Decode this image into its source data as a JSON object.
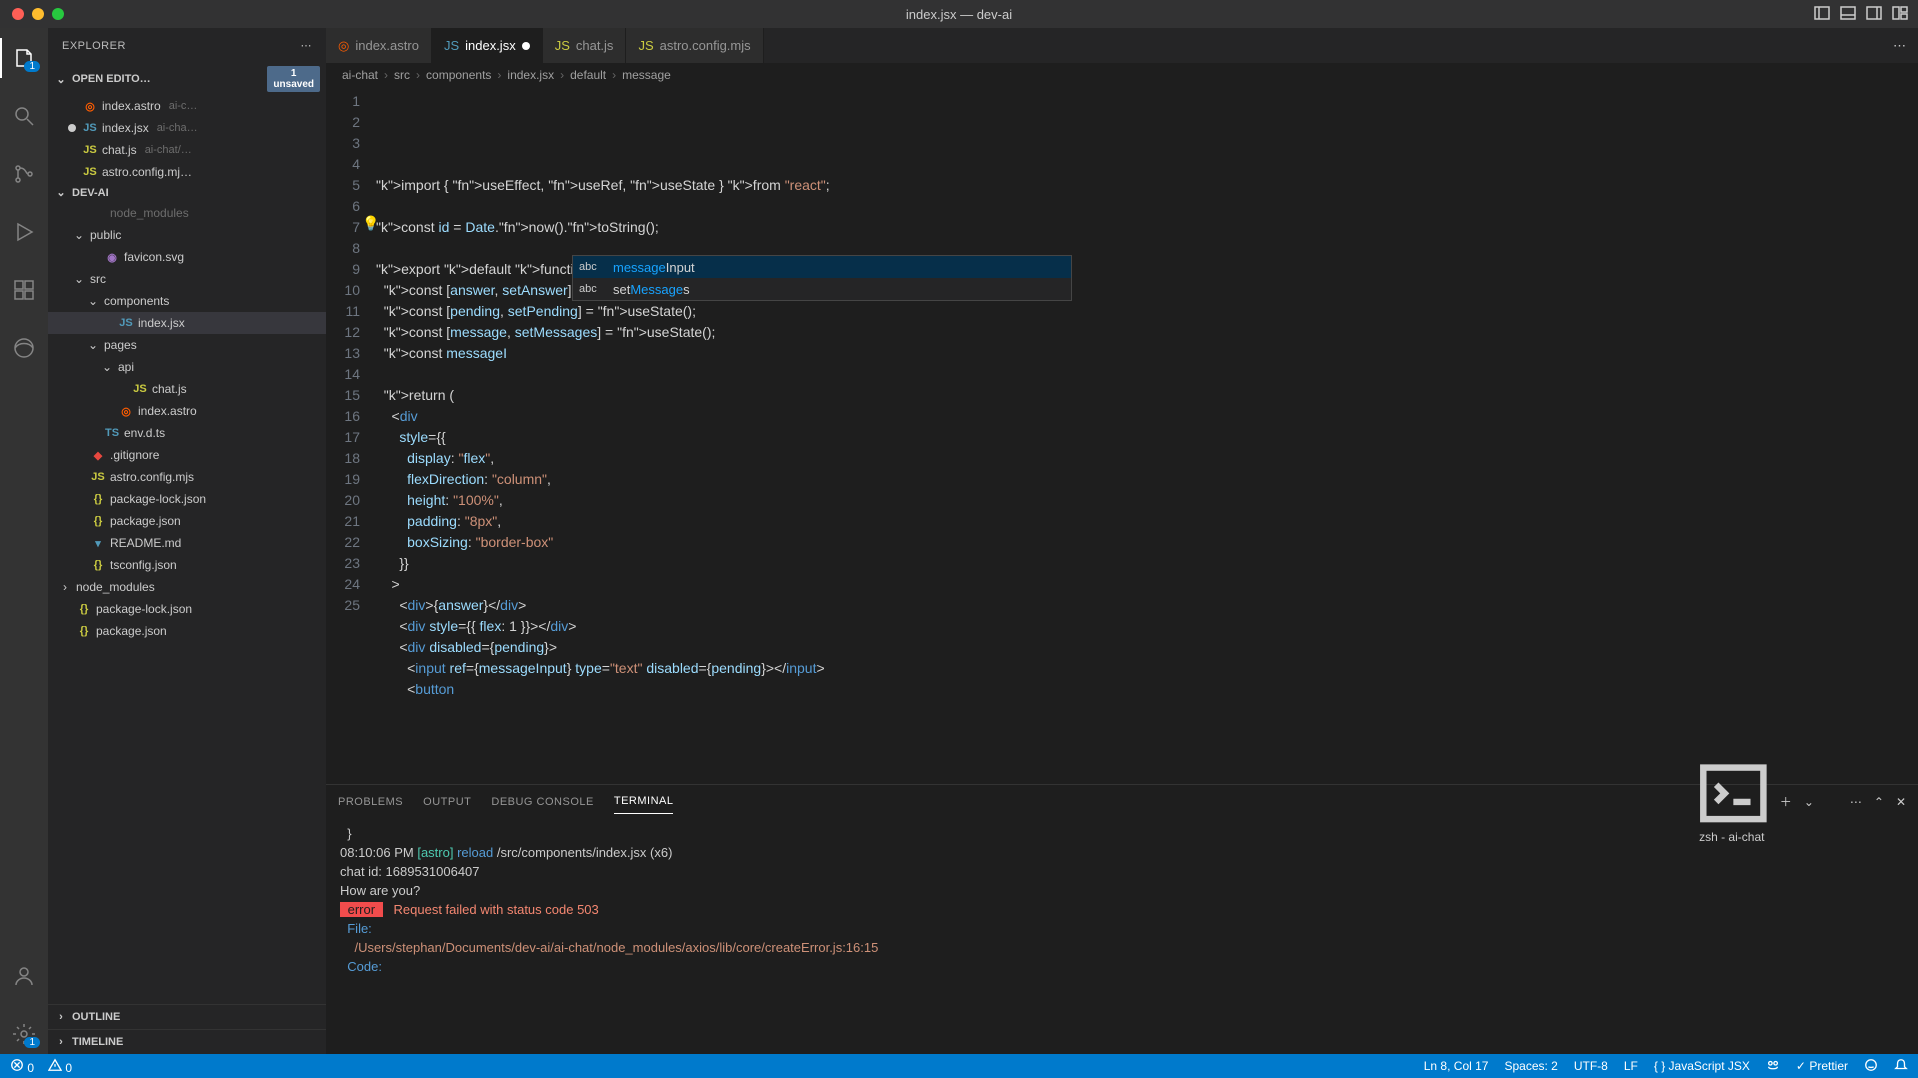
{
  "title": "index.jsx — dev-ai",
  "explorer": {
    "title": "EXPLORER"
  },
  "openEditors": {
    "title": "OPEN EDITO…",
    "unsaved": "1\nunsaved",
    "items": [
      {
        "name": "index.astro",
        "hint": "ai-c…",
        "icon": "astro",
        "modified": false
      },
      {
        "name": "index.jsx",
        "hint": "ai-cha…",
        "icon": "jsx",
        "modified": true
      },
      {
        "name": "chat.js",
        "hint": "ai-chat/…",
        "icon": "js",
        "modified": false
      },
      {
        "name": "astro.config.mj…",
        "hint": "",
        "icon": "js",
        "modified": false
      }
    ]
  },
  "project": {
    "name": "DEV-AI",
    "tree": [
      {
        "depth": 1,
        "type": "file",
        "icon": "",
        "label": "node_modules",
        "dim": true
      },
      {
        "depth": 1,
        "type": "folder",
        "open": true,
        "label": "public"
      },
      {
        "depth": 2,
        "type": "file",
        "icon": "svg",
        "label": "favicon.svg"
      },
      {
        "depth": 1,
        "type": "folder",
        "open": true,
        "label": "src"
      },
      {
        "depth": 2,
        "type": "folder",
        "open": true,
        "label": "components"
      },
      {
        "depth": 3,
        "type": "file",
        "icon": "jsx",
        "label": "index.jsx",
        "selected": true
      },
      {
        "depth": 2,
        "type": "folder",
        "open": true,
        "label": "pages"
      },
      {
        "depth": 3,
        "type": "folder",
        "open": true,
        "label": "api"
      },
      {
        "depth": 4,
        "type": "file",
        "icon": "js",
        "label": "chat.js"
      },
      {
        "depth": 3,
        "type": "file",
        "icon": "astro",
        "label": "index.astro"
      },
      {
        "depth": 2,
        "type": "file",
        "icon": "ts",
        "label": "env.d.ts"
      },
      {
        "depth": 1,
        "type": "file",
        "icon": "git",
        "label": ".gitignore"
      },
      {
        "depth": 1,
        "type": "file",
        "icon": "js",
        "label": "astro.config.mjs"
      },
      {
        "depth": 1,
        "type": "file",
        "icon": "json",
        "label": "package-lock.json"
      },
      {
        "depth": 1,
        "type": "file",
        "icon": "json",
        "label": "package.json"
      },
      {
        "depth": 1,
        "type": "file",
        "icon": "md",
        "label": "README.md"
      },
      {
        "depth": 1,
        "type": "file",
        "icon": "json",
        "label": "tsconfig.json"
      },
      {
        "depth": 0,
        "type": "folder",
        "open": false,
        "label": "node_modules"
      },
      {
        "depth": 0,
        "type": "file",
        "icon": "json",
        "label": "package-lock.json"
      },
      {
        "depth": 0,
        "type": "file",
        "icon": "json",
        "label": "package.json"
      }
    ]
  },
  "outline": "OUTLINE",
  "timeline": "TIMELINE",
  "tabs": [
    {
      "label": "index.astro",
      "icon": "astro",
      "active": false
    },
    {
      "label": "index.jsx",
      "icon": "jsx",
      "active": true,
      "modified": true
    },
    {
      "label": "chat.js",
      "icon": "js",
      "active": false
    },
    {
      "label": "astro.config.mjs",
      "icon": "js",
      "active": false
    }
  ],
  "breadcrumb": [
    "ai-chat",
    "src",
    "components",
    "index.jsx",
    "default",
    "message"
  ],
  "code": {
    "lines": [
      "import { useEffect, useRef, useState } from \"react\";",
      "",
      "const id = Date.now().toString();",
      "",
      "export default function () {",
      "  const [answer, setAnswer] = useState();",
      "  const [pending, setPending] = useState();",
      "  const [message, setMessages] = useState();",
      "  const messageI",
      "",
      "  return (",
      "    <div",
      "      style={{",
      "        display: \"flex\",",
      "        flexDirection: \"column\",",
      "        height: \"100%\",",
      "        padding: \"8px\",",
      "        boxSizing: \"border-box\"",
      "      }}",
      "    >",
      "      <div>{answer}</div>",
      "      <div style={{ flex: 1 }}></div>",
      "      <div disabled={pending}>",
      "        <input ref={messageInput} type=\"text\" disabled={pending}></input>",
      "        <button"
    ]
  },
  "autocomplete": {
    "items": [
      {
        "kind": "abc",
        "match": "message",
        "rest": "Input",
        "selected": true
      },
      {
        "kind": "abc",
        "prefix": "set",
        "match": "Message",
        "rest": "s",
        "selected": false
      }
    ]
  },
  "panel": {
    "tabs": [
      "PROBLEMS",
      "OUTPUT",
      "DEBUG CONSOLE",
      "TERMINAL"
    ],
    "active": 3,
    "termLabel": "zsh - ai-chat",
    "lines": [
      {
        "text": "  }"
      },
      {
        "segments": [
          {
            "t": "08:10:06 PM ",
            "c": ""
          },
          {
            "t": "[astro]",
            "c": "astro"
          },
          {
            "t": " ",
            "c": ""
          },
          {
            "t": "reload",
            "c": "reload"
          },
          {
            "t": " /src/components/index.jsx (x6)",
            "c": ""
          }
        ]
      },
      {
        "text": "chat id: 1689531006407"
      },
      {
        "text": "How are you?"
      },
      {
        "segments": [
          {
            "t": " error ",
            "c": "err"
          },
          {
            "t": "   Request failed with status code 503",
            "c": "red"
          }
        ]
      },
      {
        "segments": [
          {
            "t": "  File:",
            "c": "blue"
          }
        ]
      },
      {
        "segments": [
          {
            "t": "    /Users/stephan/Documents/dev-ai/ai-chat/node_modules/axios/lib/core/createError.js:16:15",
            "c": "file"
          }
        ]
      },
      {
        "segments": [
          {
            "t": "  Code:",
            "c": "blue"
          }
        ]
      }
    ]
  },
  "status": {
    "errors": "0",
    "warnings": "0",
    "pos": "Ln 8, Col 17",
    "spaces": "Spaces: 2",
    "enc": "UTF-8",
    "eol": "LF",
    "lang": "JavaScript JSX",
    "prettier": "Prettier"
  }
}
